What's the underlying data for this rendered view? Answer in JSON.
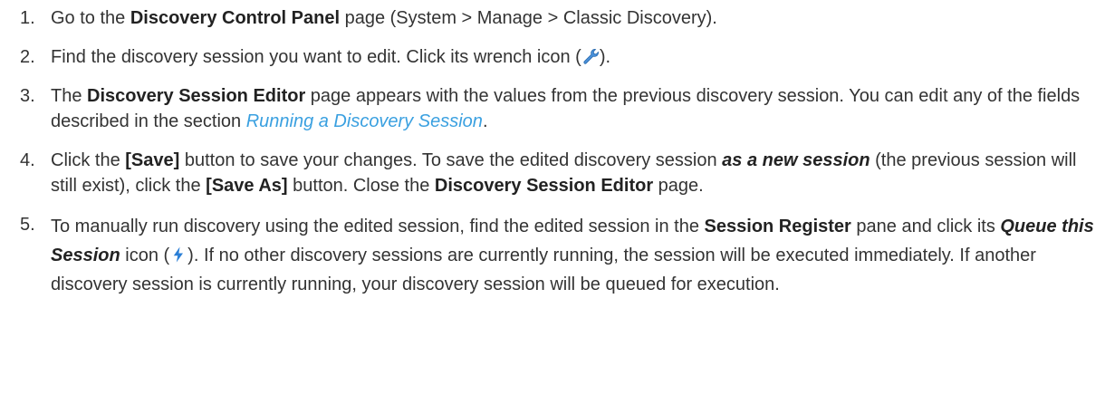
{
  "steps": [
    {
      "num": "1.",
      "t1": "Go to the ",
      "b1": "Discovery Control Panel",
      "t2": " page (System > Manage > Classic Discovery)."
    },
    {
      "num": "2.",
      "t1": "Find the discovery session you want to edit. Click its wrench icon (",
      "icon": "wrench-icon",
      "t2": ")."
    },
    {
      "num": "3.",
      "t1": "The ",
      "b1": "Discovery Session Editor",
      "t2": " page appears with the values from the previous discovery session. You can edit any of the fields described in the section ",
      "link": "Running a Discovery Session",
      "t3": "."
    },
    {
      "num": "4.",
      "t1": "Click the ",
      "b1": "[Save]",
      "t2": " button to save your changes. To save the edited discovery session ",
      "bi1": "as a new session",
      "t3": " (the previous session will still exist), click the ",
      "b2": "[Save As]",
      "t4": " button. Close the ",
      "b3": "Discovery Session Editor",
      "t5": " page."
    },
    {
      "num": "5.",
      "t1": "To manually run discovery using the edited session, find the edited session in the ",
      "b1": "Session Register",
      "t2": " pane and click its ",
      "bi1": "Queue this Session",
      "t3": " icon (",
      "icon": "lightning-icon",
      "t4": "). If no other discovery sessions are currently running, the session will be executed immediately. If another discovery session is currently running, your discovery session will be queued for execution."
    }
  ],
  "colors": {
    "text": "#333333",
    "link": "#3aa0e0",
    "wrench": "#4a90d9",
    "lightning": "#2b7fd6"
  }
}
